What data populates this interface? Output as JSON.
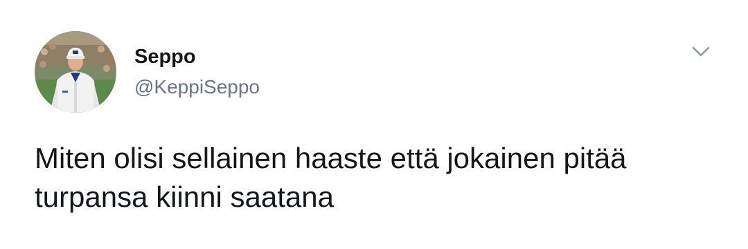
{
  "tweet": {
    "author": {
      "display_name": "Seppo",
      "handle": "@KeppiSeppo",
      "avatar": "avatar-photo"
    },
    "menu_icon": "chevron-down-icon",
    "text": "Miten olisi sellainen haaste että jokainen pitää turpansa kiinni saatana"
  },
  "colors": {
    "name": "#14171a",
    "handle": "#657786",
    "chevron": "#8899a6",
    "background": "#ffffff"
  }
}
